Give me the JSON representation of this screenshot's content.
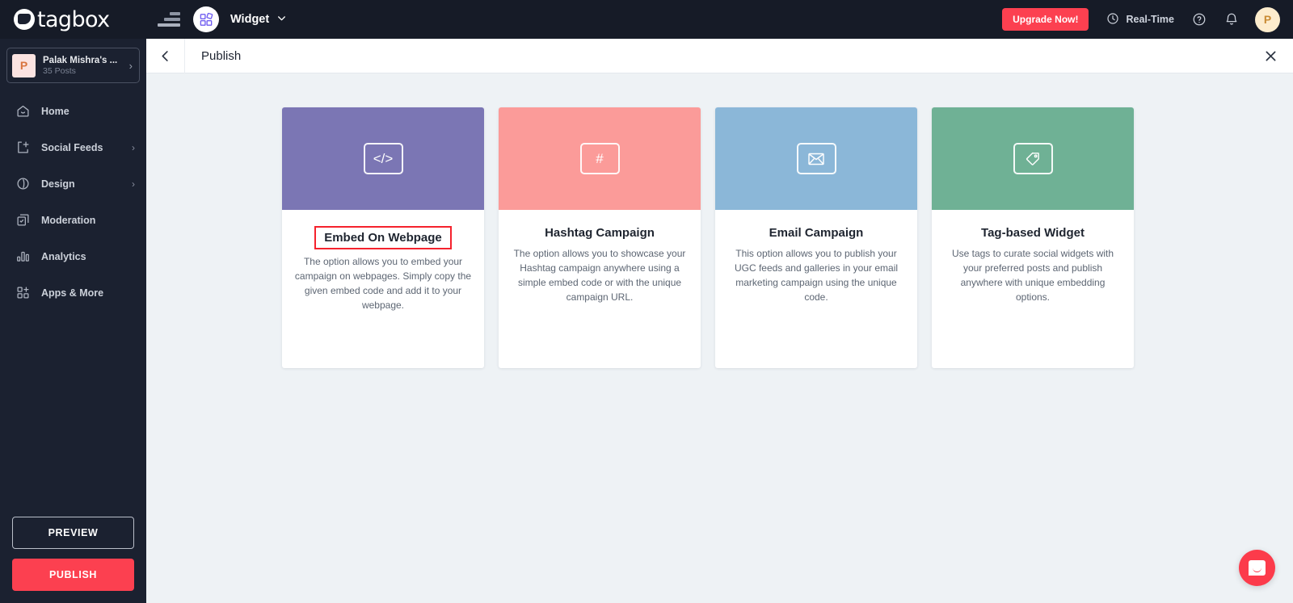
{
  "brand": {
    "name": "tagbox",
    "accent_red": "#fc4050",
    "sidebar_bg": "#1b2130",
    "topbar_bg": "#161b27"
  },
  "sidebar": {
    "workspace": {
      "avatar_initial": "P",
      "name": "Palak Mishra's ...",
      "posts": "35 Posts",
      "chevron": "›"
    },
    "items": [
      {
        "label": "Home",
        "icon": "home-icon",
        "has_chevron": false
      },
      {
        "label": "Social Feeds",
        "icon": "add-feed-icon",
        "has_chevron": true,
        "chevron": "›"
      },
      {
        "label": "Design",
        "icon": "design-icon",
        "has_chevron": true,
        "chevron": "›"
      },
      {
        "label": "Moderation",
        "icon": "moderation-icon",
        "has_chevron": false
      },
      {
        "label": "Analytics",
        "icon": "analytics-icon",
        "has_chevron": false
      },
      {
        "label": "Apps & More",
        "icon": "apps-icon",
        "has_chevron": false
      }
    ],
    "preview_label": "PREVIEW",
    "publish_label": "PUBLISH"
  },
  "topbar": {
    "menu_icon": "stacked-bars-icon",
    "widget_icon": "widget-grid-icon",
    "widget_label": "Widget",
    "widget_caret": "⌄",
    "upgrade_label": "Upgrade Now!",
    "realtime_label": "Real-Time",
    "realtime_icon": "clock-icon",
    "help_icon": "help-circle-icon",
    "notification_icon": "bell-icon",
    "avatar_initial": "P"
  },
  "pagebar": {
    "back_icon": "chevron-left-icon",
    "title": "Publish",
    "close_icon": "close-icon"
  },
  "cards": [
    {
      "id": "embed-on-webpage",
      "title": "Embed On Webpage",
      "description": "The option allows you to embed your campaign on webpages. Simply copy the given embed code and add it to your webpage.",
      "header_color": "#7b76b4",
      "icon": "code-icon",
      "glyph": "</>",
      "selected": true
    },
    {
      "id": "hashtag-campaign",
      "title": "Hashtag Campaign",
      "description": "The option allows you to showcase your Hashtag campaign anywhere using a simple embed code or with the unique campaign URL.",
      "header_color": "#fb9b99",
      "icon": "hashtag-icon",
      "glyph": "#",
      "selected": false
    },
    {
      "id": "email-campaign",
      "title": "Email Campaign",
      "description": "This option allows you to publish your UGC feeds and galleries in your email marketing campaign using the unique code.",
      "header_color": "#8bb7d8",
      "icon": "envelope-icon",
      "glyph": "",
      "selected": false
    },
    {
      "id": "tag-based-widget",
      "title": "Tag-based Widget",
      "description": "Use tags to curate social widgets with your preferred posts and publish anywhere with unique embedding options.",
      "header_color": "#6fb195",
      "icon": "tag-icon",
      "glyph": "",
      "selected": false
    }
  ],
  "chat": {
    "icon": "intercom-chat-icon"
  }
}
